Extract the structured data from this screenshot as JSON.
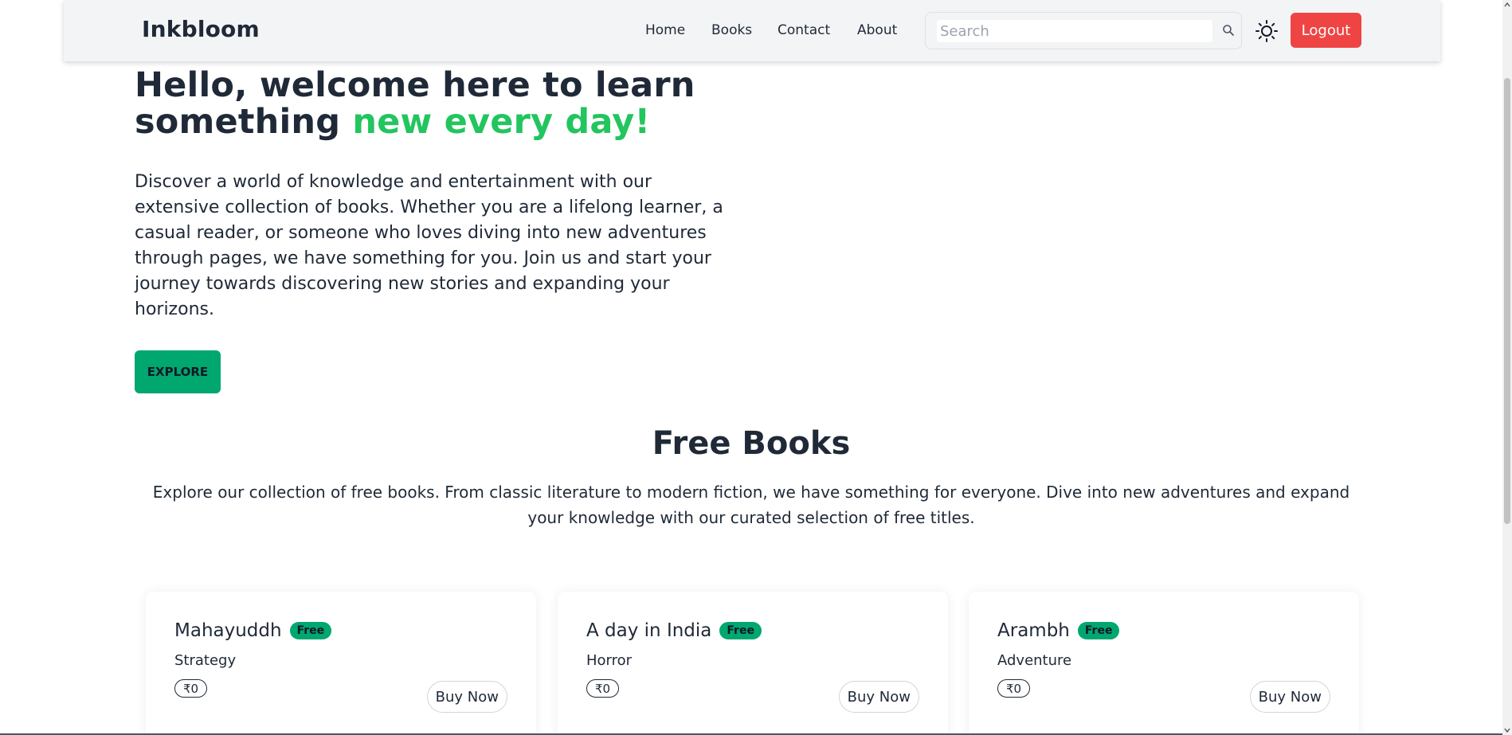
{
  "navbar": {
    "brand": "Inkbloom",
    "links": [
      "Home",
      "Books",
      "Contact",
      "About"
    ],
    "search_placeholder": "Search",
    "search_icon": "search-icon",
    "theme_icon": "sun-icon",
    "logout_label": "Logout",
    "logout_color": "#ef4444"
  },
  "hero": {
    "title_main": "Hello, welcome here to learn something ",
    "title_accent": "new every day!",
    "accent_color": "#22c55e",
    "description": "Discover a world of knowledge and entertainment with our extensive collection of books. Whether you are a lifelong learner, a casual reader, or someone who loves diving into new adventures through pages, we have something for you. Join us and start your journey towards discovering new stories and expanding your horizons.",
    "explore_label": "EXPLORE",
    "explore_color": "#00a76f"
  },
  "free_books": {
    "title": "Free Books",
    "description": "Explore our collection of free books. From classic literature to modern fiction, we have something for everyone. Dive into new adventures and expand your knowledge with our curated selection of free titles.",
    "cards": [
      {
        "title": "Mahayuddh",
        "badge": "Free",
        "category": "Strategy",
        "price": "₹0",
        "buy_label": "Buy Now"
      },
      {
        "title": "A day in India",
        "badge": "Free",
        "category": "Horror",
        "price": "₹0",
        "buy_label": "Buy Now"
      },
      {
        "title": "Arambh",
        "badge": "Free",
        "category": "Adventure",
        "price": "₹0",
        "buy_label": "Buy Now"
      }
    ]
  }
}
